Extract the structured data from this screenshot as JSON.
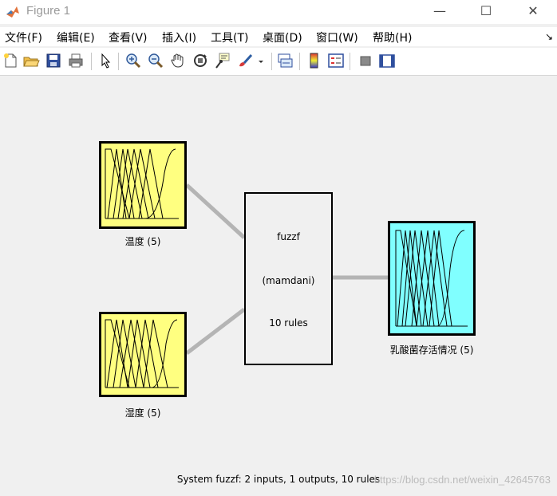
{
  "window": {
    "title": "Figure 1",
    "minimize_glyph": "—",
    "maximize_glyph": "☐",
    "close_glyph": "✕"
  },
  "menu": {
    "items": [
      "文件(F)",
      "编辑(E)",
      "查看(V)",
      "插入(I)",
      "工具(T)",
      "桌面(D)",
      "窗口(W)",
      "帮助(H)"
    ],
    "dock_glyph": "↘"
  },
  "toolbar": {
    "icons": [
      "new-figure-icon",
      "open-file-icon",
      "save-icon",
      "print-icon",
      "select-arrow-icon",
      "zoom-in-icon",
      "zoom-out-icon",
      "pan-hand-icon",
      "rotate-3d-icon",
      "data-cursor-icon",
      "brush-icon",
      "link-plot-icon",
      "colorbar-icon",
      "legend-icon",
      "hide-plot-tools-icon",
      "show-plot-tools-icon"
    ]
  },
  "fis": {
    "name": "fuzzf",
    "type_label": "(mamdani)",
    "rules_label": "10 rules",
    "inputs": [
      {
        "label": "温度 (5)",
        "color": "#ffff80"
      },
      {
        "label": "湿度 (5)",
        "color": "#ffff80"
      }
    ],
    "outputs": [
      {
        "label": "乳酸菌存活情况 (5)",
        "color": "#80ffff"
      }
    ],
    "status": "System fuzzf: 2 inputs, 1 outputs, 10 rules"
  },
  "watermark": "https://blog.csdn.net/weixin_42645763"
}
